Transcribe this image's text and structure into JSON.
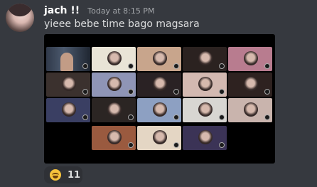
{
  "message": {
    "author": "jach !!",
    "timestamp": "Today at 8:15 PM",
    "text": "yieee bebe time bago magsara"
  },
  "attachment": {
    "type": "image",
    "description_icon": "video-call-grid-screenshot",
    "tiles": [
      {
        "kind": "camera",
        "bg": "#3a4255"
      },
      {
        "kind": "avatar",
        "bg": "#e9e4d6"
      },
      {
        "kind": "avatar",
        "bg": "#c8a58c"
      },
      {
        "kind": "avatar",
        "bg": "#2b2220"
      },
      {
        "kind": "avatar",
        "bg": "#b87c8f"
      },
      {
        "kind": "avatar",
        "bg": "#3b312e"
      },
      {
        "kind": "avatar",
        "bg": "#8f95b6"
      },
      {
        "kind": "avatar",
        "bg": "#2a2224"
      },
      {
        "kind": "avatar",
        "bg": "#d3b9b1"
      },
      {
        "kind": "avatar",
        "bg": "#2e2220"
      },
      {
        "kind": "avatar",
        "bg": "#3a3f63"
      },
      {
        "kind": "avatar",
        "bg": "#2b2523"
      },
      {
        "kind": "avatar",
        "bg": "#8da0c2"
      },
      {
        "kind": "avatar",
        "bg": "#d8d6d2"
      },
      {
        "kind": "avatar",
        "bg": "#c9b4ad"
      },
      {
        "kind": "avatar",
        "bg": "#9a5a3f"
      },
      {
        "kind": "avatar",
        "bg": "#e4d6c4"
      },
      {
        "kind": "avatar",
        "bg": "#3b3356"
      }
    ]
  },
  "reaction": {
    "emoji_icon": "laughing-face-icon",
    "count": "11"
  }
}
